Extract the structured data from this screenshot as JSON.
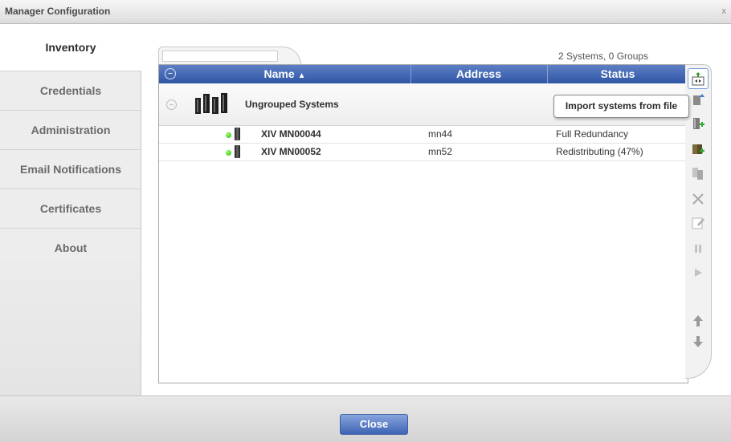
{
  "window": {
    "title": "Manager Configuration",
    "close_glyph": "x"
  },
  "tabs": [
    {
      "label": "Inventory",
      "active": true
    },
    {
      "label": "Credentials",
      "active": false
    },
    {
      "label": "Administration",
      "active": false
    },
    {
      "label": "Email Notifications",
      "active": false
    },
    {
      "label": "Certificates",
      "active": false
    },
    {
      "label": "About",
      "active": false
    }
  ],
  "inventory": {
    "search": {
      "value": "",
      "placeholder": ""
    },
    "summary": "2 Systems, 0 Groups",
    "columns": {
      "name": "Name",
      "address": "Address",
      "status": "Status"
    },
    "sort": {
      "column": "Name",
      "direction": "ascending"
    },
    "group": {
      "name": "Ungrouped Systems",
      "expanded": true
    },
    "systems": [
      {
        "name": "XIV MN00044",
        "address": "mn44",
        "status": "Full Redundancy",
        "online": true
      },
      {
        "name": "XIV MN00052",
        "address": "mn52",
        "status": "Redistributing (47%)",
        "online": true
      }
    ],
    "tooltip": "Import systems from file"
  },
  "toolbar": {
    "buttons": [
      "import-systems-icon",
      "export-icon",
      "add-system-icon",
      "add-group-icon",
      "copy-icon",
      "delete-icon",
      "edit-icon",
      "pause-icon",
      "play-icon",
      "move-up-icon",
      "move-down-icon"
    ]
  },
  "footer": {
    "close_label": "Close"
  },
  "colors": {
    "header_blue": "#2f55a4",
    "status_green": "#23b515",
    "button_blue": "#3d64b3"
  }
}
